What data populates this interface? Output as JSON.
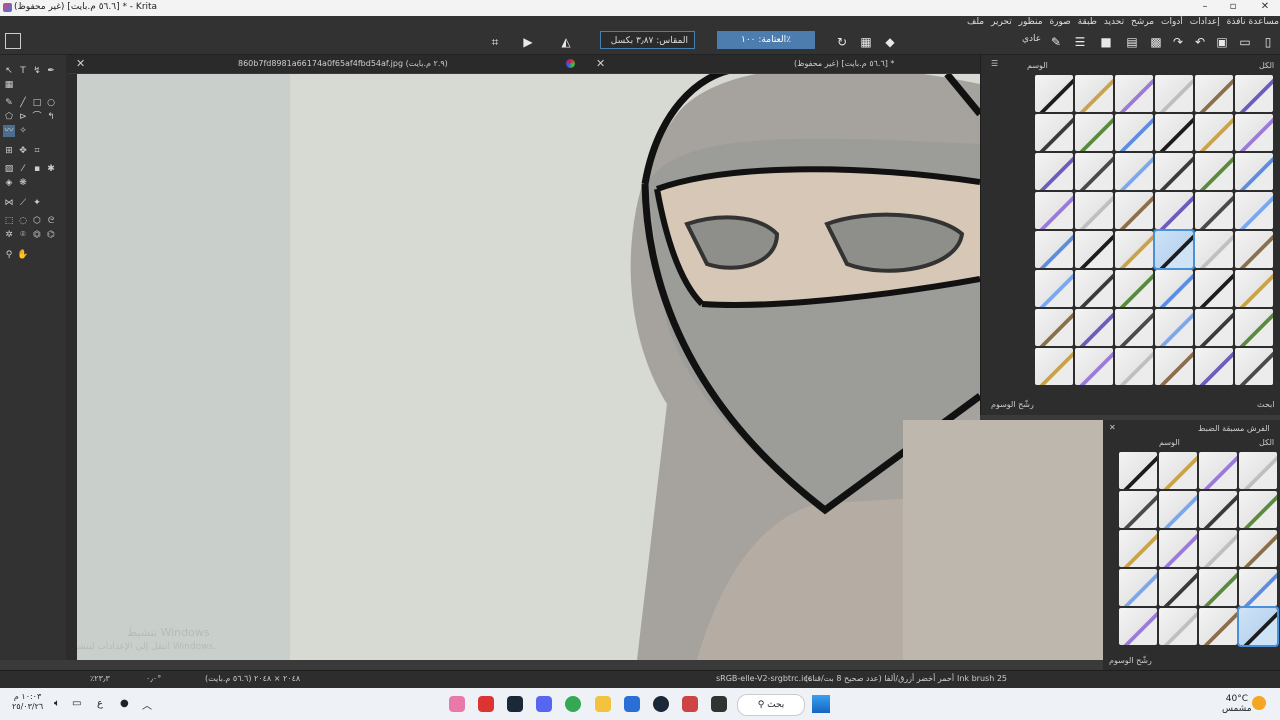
{
  "window": {
    "title": "(غير محفوظ) [٥٦.٦ م.بايت] * - Krita"
  },
  "menu": [
    "ملف",
    "تحرير",
    "منظور",
    "صورة",
    "طبقة",
    "تحديد",
    "مرشح",
    "أدوات",
    "إعدادات",
    "نافذة",
    "مساعدة"
  ],
  "toolbar": {
    "size_label": "المقاس: ٣٫٨٧ بكسل",
    "opacity_label": "العتامة: ١٠٠٪",
    "blend_mode": "عادي"
  },
  "tabs": [
    {
      "label": "(غير محفوظ) [٥٦.٦ م.بايت] *"
    },
    {
      "label": "860b7fd8981a66174a0f65af4fbd54af.jpg (٢.٩ م.بايت)"
    }
  ],
  "brush_docker": {
    "title": "الكل",
    "tag_label": "الوسم",
    "filter_label": "رشّح الوسوم",
    "search_label": "ابحث"
  },
  "brush_docker2": {
    "title": "الفرش مسبقة الضبط",
    "tag_label": "الوسم",
    "all_label": "الكل",
    "filter_label": "رشّح الوسوم",
    "search_label": "ابحث"
  },
  "status": {
    "brush_name": "Ink brush 25",
    "color_info": "أحمر أخضر أزرق/ألفا (عدد صحيح 8 بت/قناة)",
    "profile": "sRGB-elle-V2-srgbtrc.icc",
    "image_size": "٢٠٤٨ × ٢٠٤٨ (٥٦.٦ م.بايت)",
    "rotation": "٠٫٠°",
    "zoom": "٪٢٣٫٣"
  },
  "taskbar": {
    "search_label": "بحث",
    "weather_temp": "40°C",
    "weather_desc": "مشمس",
    "time": "١٠:٠٣ م",
    "date": "٢٥/٠٣/٢٦",
    "lang": "ع"
  },
  "watermark": {
    "line1": "تنشيط Windows",
    "line2": "انتقل إلى الإعدادات لتنشيط Windows."
  },
  "colors": {
    "accent": "#4d7cae",
    "panel": "#323232",
    "canvas": "#d7d9d3"
  }
}
